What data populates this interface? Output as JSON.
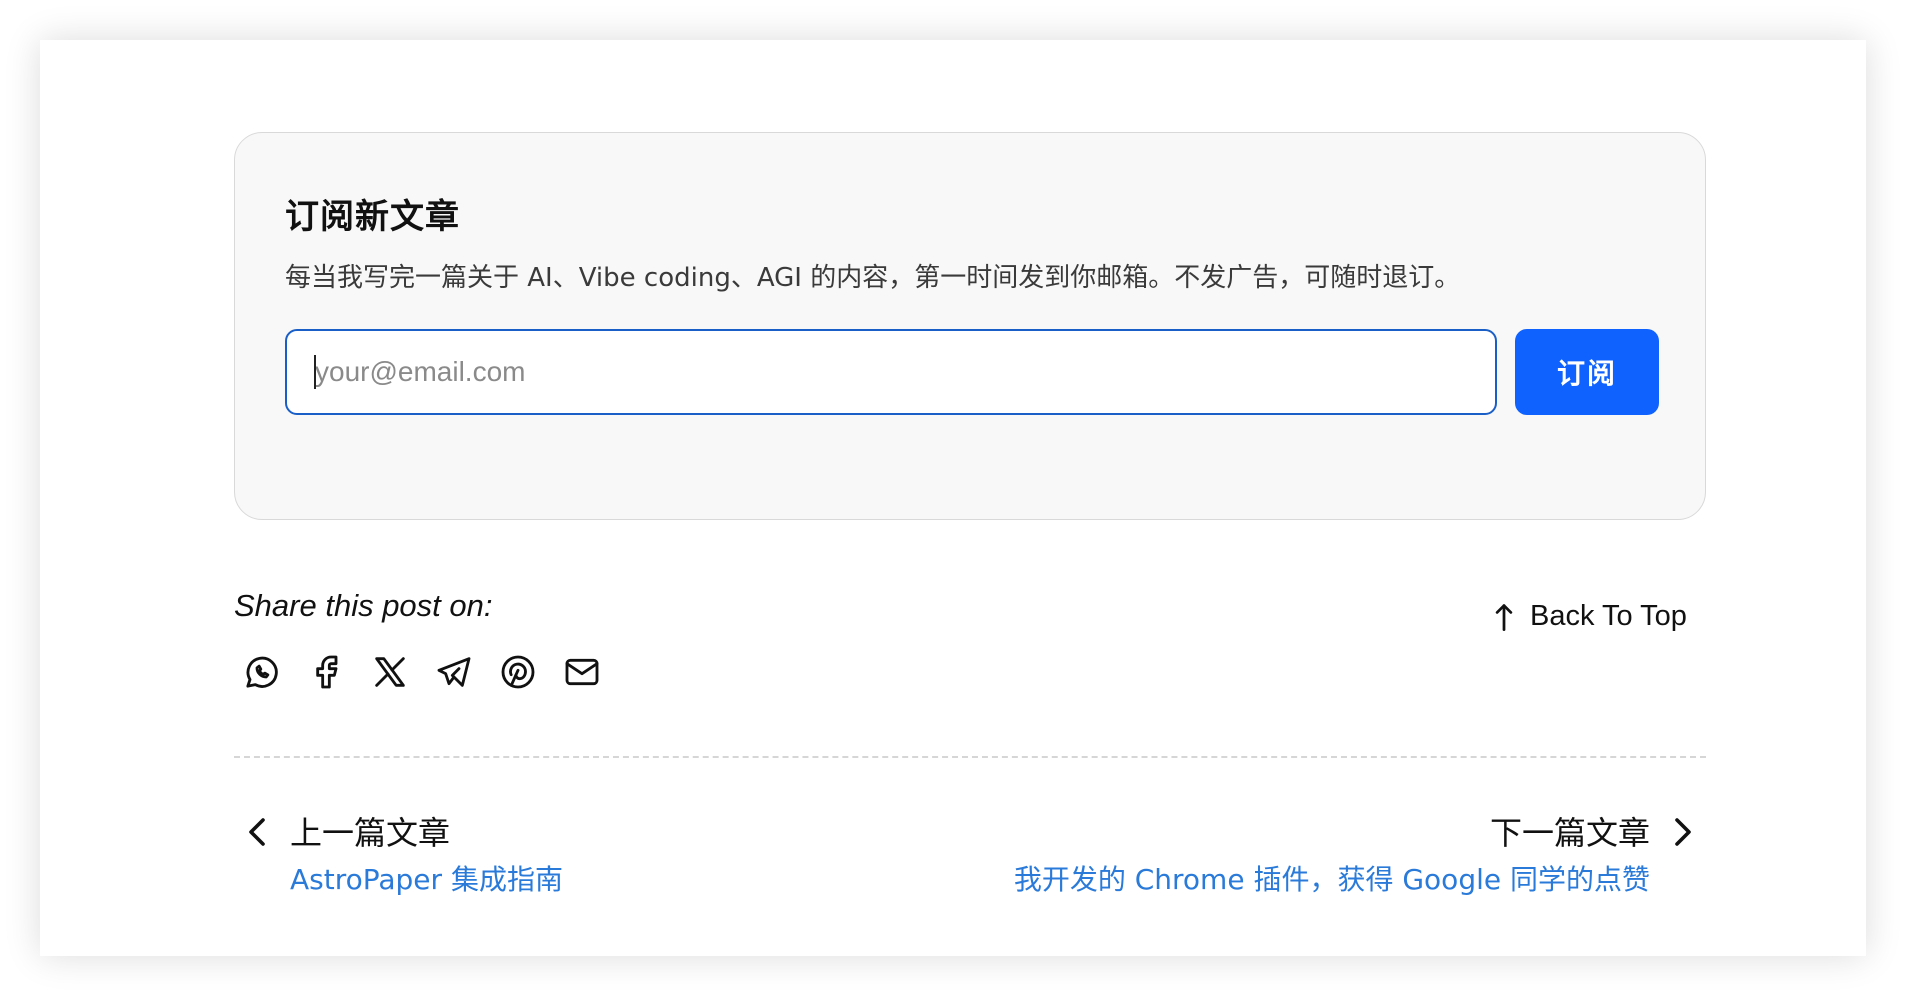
{
  "subscribe": {
    "title": "订阅新文章",
    "description": "每当我写完一篇关于 AI、Vibe coding、AGI 的内容，第一时间发到你邮箱。不发广告，可随时退订。",
    "email_placeholder": "your@email.com",
    "email_value": "",
    "button_label": "订阅",
    "accent_color": "#0f62fe"
  },
  "share": {
    "label": "Share this post on:",
    "icons": [
      "whatsapp-icon",
      "facebook-icon",
      "x-icon",
      "telegram-icon",
      "pinterest-icon",
      "mail-icon"
    ]
  },
  "back_to_top": {
    "label": "Back To Top",
    "icon": "arrow-up-icon"
  },
  "pagination": {
    "prev": {
      "label": "上一篇文章",
      "title": "AstroPaper 集成指南",
      "icon": "chevron-left-icon"
    },
    "next": {
      "label": "下一篇文章",
      "title": "我开发的 Chrome 插件，获得 Google 同学的点赞",
      "icon": "chevron-right-icon"
    },
    "link_color": "#2a7ad9"
  }
}
